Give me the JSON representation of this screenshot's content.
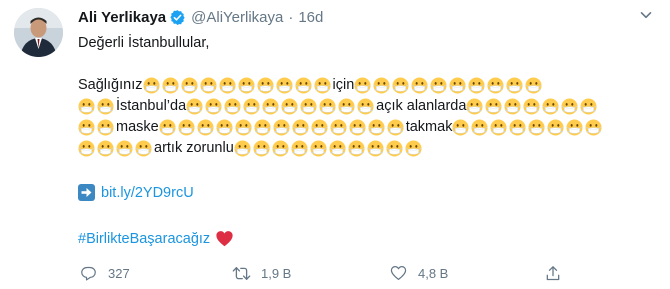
{
  "tweet": {
    "display_name": "Ali Yerlikaya",
    "handle": "@AliYerlikaya",
    "separator": "·",
    "time": "16d",
    "greeting": "Değerli İstanbullular,",
    "body_lines": [
      [
        {
          "t": "text",
          "v": "Sağlığınız"
        },
        {
          "t": "mask",
          "n": 10
        },
        {
          "t": "text",
          "v": "için"
        },
        {
          "t": "mask",
          "n": 10
        }
      ],
      [
        {
          "t": "mask",
          "n": 2
        },
        {
          "t": "text",
          "v": "İstanbul’da"
        },
        {
          "t": "mask",
          "n": 10
        },
        {
          "t": "text",
          "v": "açık alanlarda"
        },
        {
          "t": "mask",
          "n": 7
        }
      ],
      [
        {
          "t": "mask",
          "n": 2
        },
        {
          "t": "text",
          "v": "maske"
        },
        {
          "t": "mask",
          "n": 13
        },
        {
          "t": "text",
          "v": "takmak"
        },
        {
          "t": "mask",
          "n": 8
        }
      ],
      [
        {
          "t": "mask",
          "n": 4
        },
        {
          "t": "text",
          "v": "artık zorunlu"
        },
        {
          "t": "mask",
          "n": 10
        }
      ]
    ],
    "emoji_names": {
      "mask": "face-with-medical-mask-emoji"
    },
    "link_text": "bit.ly/2YD9rcU",
    "hashtag": "#BirlikteBaşaracağız",
    "actions": {
      "reply_count": "327",
      "retweet_count": "1,9 B",
      "like_count": "4,8 B"
    }
  },
  "colors": {
    "link_blue": "#1b95e0",
    "verified_blue": "#1da1f2",
    "muted_gray": "#657786",
    "text_dark": "#14171a",
    "heart_red": "#dd2e44",
    "emoji_yellow": "#ffcc4d"
  }
}
